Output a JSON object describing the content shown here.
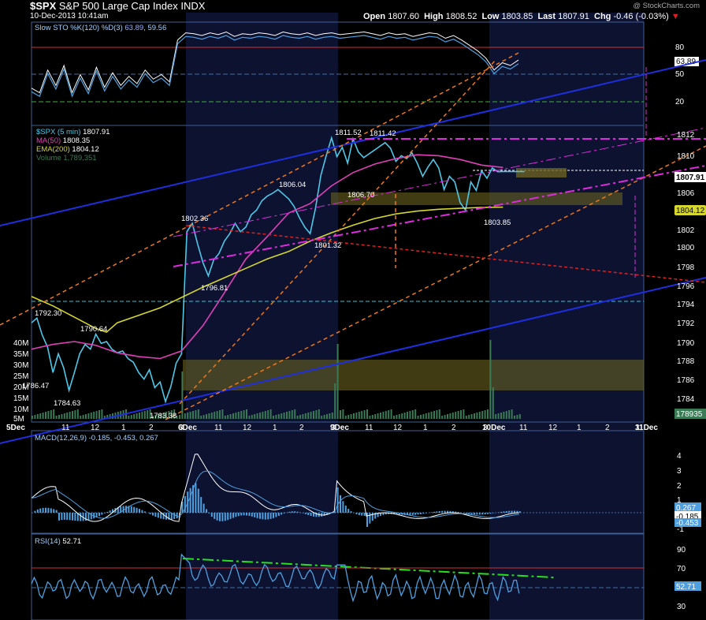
{
  "header": {
    "symbol": "$SPX",
    "name": "S&P 500 Large Cap Index",
    "exchange": "INDX",
    "date": "10-Dec-2013 10:41am",
    "open_label": "Open",
    "open": "1807.60",
    "high_label": "High",
    "high": "1808.52",
    "low_label": "Low",
    "low": "1803.85",
    "last_label": "Last",
    "last": "1807.91",
    "chg_label": "Chg",
    "chg": "-0.46 (-0.03%)",
    "watermark": "@ StockCharts.com"
  },
  "colors": {
    "background": "#000000",
    "panel_border": "#4a6fa5",
    "session_shade": "#0d1330",
    "price": "#4fc7e8",
    "ma50": "#e040b8",
    "ema200": "#d6d630",
    "volume": "#3a7a55",
    "trend_blue": "#1e2fe0",
    "trend_orange": "#f07818",
    "trend_red": "#e02020",
    "trend_magenta": "#e02ae0",
    "rsi_green": "#28e020",
    "zone_yellow": "#6a6220",
    "macd_hist": "#4fa0e0"
  },
  "sto_panel": {
    "legend": "Slow STO %K(120) %D(3)",
    "k": "63.89",
    "d": "59.56",
    "ticks": [
      "80",
      "50",
      "20"
    ],
    "last_label": "63.89",
    "k_series": [
      35,
      30,
      55,
      38,
      60,
      30,
      50,
      33,
      58,
      36,
      52,
      38,
      48,
      40,
      55,
      45,
      50,
      42,
      88,
      96,
      95,
      93,
      96,
      94,
      97,
      92,
      95,
      94,
      96,
      95,
      93,
      97,
      95,
      94,
      96,
      93,
      95,
      96,
      94,
      95,
      96,
      97,
      95,
      93,
      96,
      94,
      95,
      92,
      94,
      96,
      95,
      90,
      93,
      88,
      82,
      76,
      68,
      55,
      63,
      60,
      66
    ]
  },
  "price_panel": {
    "legend_symbol": "$SPX (5 min)",
    "legend_last": "1807.91",
    "legend_ma": "MA(50)",
    "legend_ma_val": "1808.35",
    "legend_ema": "EMA(200)",
    "legend_ema_val": "1804.12",
    "legend_vol": "Volume",
    "legend_vol_val": "1,789,351",
    "price_ticks": [
      "1812",
      "1810",
      "1806",
      "1802",
      "1800",
      "1798",
      "1796",
      "1794",
      "1792",
      "1790",
      "1788",
      "1786",
      "1784"
    ],
    "vol_ticks": [
      "40M",
      "35M",
      "30M",
      "25M",
      "20M",
      "15M",
      "10M",
      "5M"
    ],
    "last_price_label": "1807.91",
    "ema_label": "1804.12",
    "vol_label": "178935",
    "annotations": [
      "1792.30",
      "1790.64",
      "1786.47",
      "1784.63",
      "1783.38",
      "1802.36",
      "1796.81",
      "1806.04",
      "1801.32",
      "1811.52",
      "1811.42",
      "1806.70",
      "1803.85"
    ],
    "x_ticks": [
      "5Dec",
      "11",
      "12",
      "1",
      "2",
      "3",
      "6Dec",
      "11",
      "12",
      "1",
      "2",
      "3",
      "9Dec",
      "11",
      "12",
      "1",
      "2",
      "3",
      "10Dec",
      "11",
      "12",
      "1",
      "2",
      "3",
      "11Dec"
    ]
  },
  "macd_panel": {
    "legend": "MACD(12,26,9)",
    "values": "-0.185, -0.453, 0.267",
    "ticks": [
      "4",
      "3",
      "2",
      "1",
      "0",
      "-1"
    ],
    "labels": [
      "0.267",
      "-0.185",
      "-0.453"
    ]
  },
  "rsi_panel": {
    "legend": "RSI(14)",
    "value": "52.71",
    "ticks": [
      "90",
      "70",
      "50",
      "30"
    ],
    "label": "52.71"
  },
  "chart_data": [
    {
      "type": "line",
      "title": "$SPX (5 min)",
      "y_range": [
        1783,
        1813.5
      ],
      "series": [
        {
          "name": "$SPX (5 min)",
          "x": [
            0,
            2,
            4,
            6,
            8,
            10,
            12,
            14,
            16,
            18,
            20,
            22,
            24,
            26,
            28,
            30,
            32,
            34,
            36,
            38,
            40,
            42,
            44,
            46,
            48,
            50,
            52,
            54,
            56,
            58,
            60,
            62,
            64,
            66,
            68,
            70,
            72,
            74,
            76,
            78,
            80,
            82,
            84,
            86,
            88,
            90,
            92,
            94,
            96,
            98,
            100,
            102,
            104,
            106,
            108,
            110,
            112,
            114,
            116,
            118,
            120,
            122,
            124,
            126,
            128,
            130,
            132,
            134,
            136,
            138,
            140,
            142,
            144,
            146,
            148,
            150,
            152,
            154,
            156,
            158,
            160,
            162,
            164,
            166,
            168,
            170,
            172,
            174,
            176,
            177,
            178,
            180,
            182,
            184
          ],
          "values": [
            1791.8,
            1792.3,
            1790.5,
            1789.2,
            1786.5,
            1788.5,
            1787.0,
            1784.6,
            1786.5,
            1788.5,
            1789.5,
            1789.0,
            1790.6,
            1789.6,
            1789.8,
            1789.0,
            1788.6,
            1788.8,
            1788.0,
            1787.6,
            1786.5,
            1785.8,
            1786.8,
            1784.9,
            1785.5,
            1783.4,
            1785.0,
            1787.5,
            1788.5,
            1801.5,
            1802.4,
            1800.2,
            1798.2,
            1796.8,
            1798.5,
            1799.2,
            1800.5,
            1801.3,
            1802.4,
            1801.5,
            1802.0,
            1803.3,
            1803.8,
            1804.8,
            1805.3,
            1805.6,
            1806.0,
            1805.5,
            1805.0,
            1804.2,
            1803.0,
            1802.0,
            1801.3,
            1804.0,
            1807.5,
            1809.6,
            1811.5,
            1809.5,
            1810.5,
            1808.8,
            1811.4,
            1810.0,
            1809.4,
            1809.8,
            1810.2,
            1810.6,
            1811.0,
            1810.4,
            1809.0,
            1809.6,
            1809.3,
            1809.9,
            1808.8,
            1807.4,
            1808.4,
            1809.2,
            1808.3,
            1806.0,
            1807.4,
            1806.8,
            1804.6,
            1803.8,
            1806.8,
            1805.9,
            1808.0,
            1807.2,
            1808.3,
            1807.9,
            1807.91,
            1807.91,
            1807.91,
            1807.91,
            1807.91,
            1807.91
          ]
        },
        {
          "name": "MA(50)",
          "x": [
            0,
            8,
            16,
            24,
            32,
            40,
            48,
            56,
            64,
            72,
            80,
            88,
            96,
            104,
            112,
            120,
            128,
            136,
            144,
            152,
            160,
            168,
            176
          ],
          "values": [
            1789.0,
            1789.5,
            1789.8,
            1789.4,
            1788.6,
            1788.2,
            1788.0,
            1788.8,
            1791.5,
            1795.0,
            1798.6,
            1801.0,
            1803.5,
            1804.5,
            1806.4,
            1807.8,
            1808.7,
            1809.3,
            1809.7,
            1809.6,
            1809.2,
            1808.6,
            1808.35
          ]
        },
        {
          "name": "EMA(200)",
          "x": [
            0,
            8,
            16,
            24,
            28,
            32,
            40,
            48,
            56,
            64,
            72,
            80,
            88,
            96,
            104,
            112,
            120,
            128,
            136,
            144,
            152,
            160,
            168,
            176
          ],
          "values": [
            1794.6,
            1793.6,
            1792.4,
            1791.2,
            1790.8,
            1791.8,
            1792.6,
            1793.4,
            1794.5,
            1795.6,
            1796.6,
            1797.6,
            1798.6,
            1799.4,
            1800.5,
            1801.4,
            1802.2,
            1802.9,
            1803.4,
            1803.7,
            1803.9,
            1804.0,
            1804.1,
            1804.12
          ]
        }
      ]
    }
  ]
}
